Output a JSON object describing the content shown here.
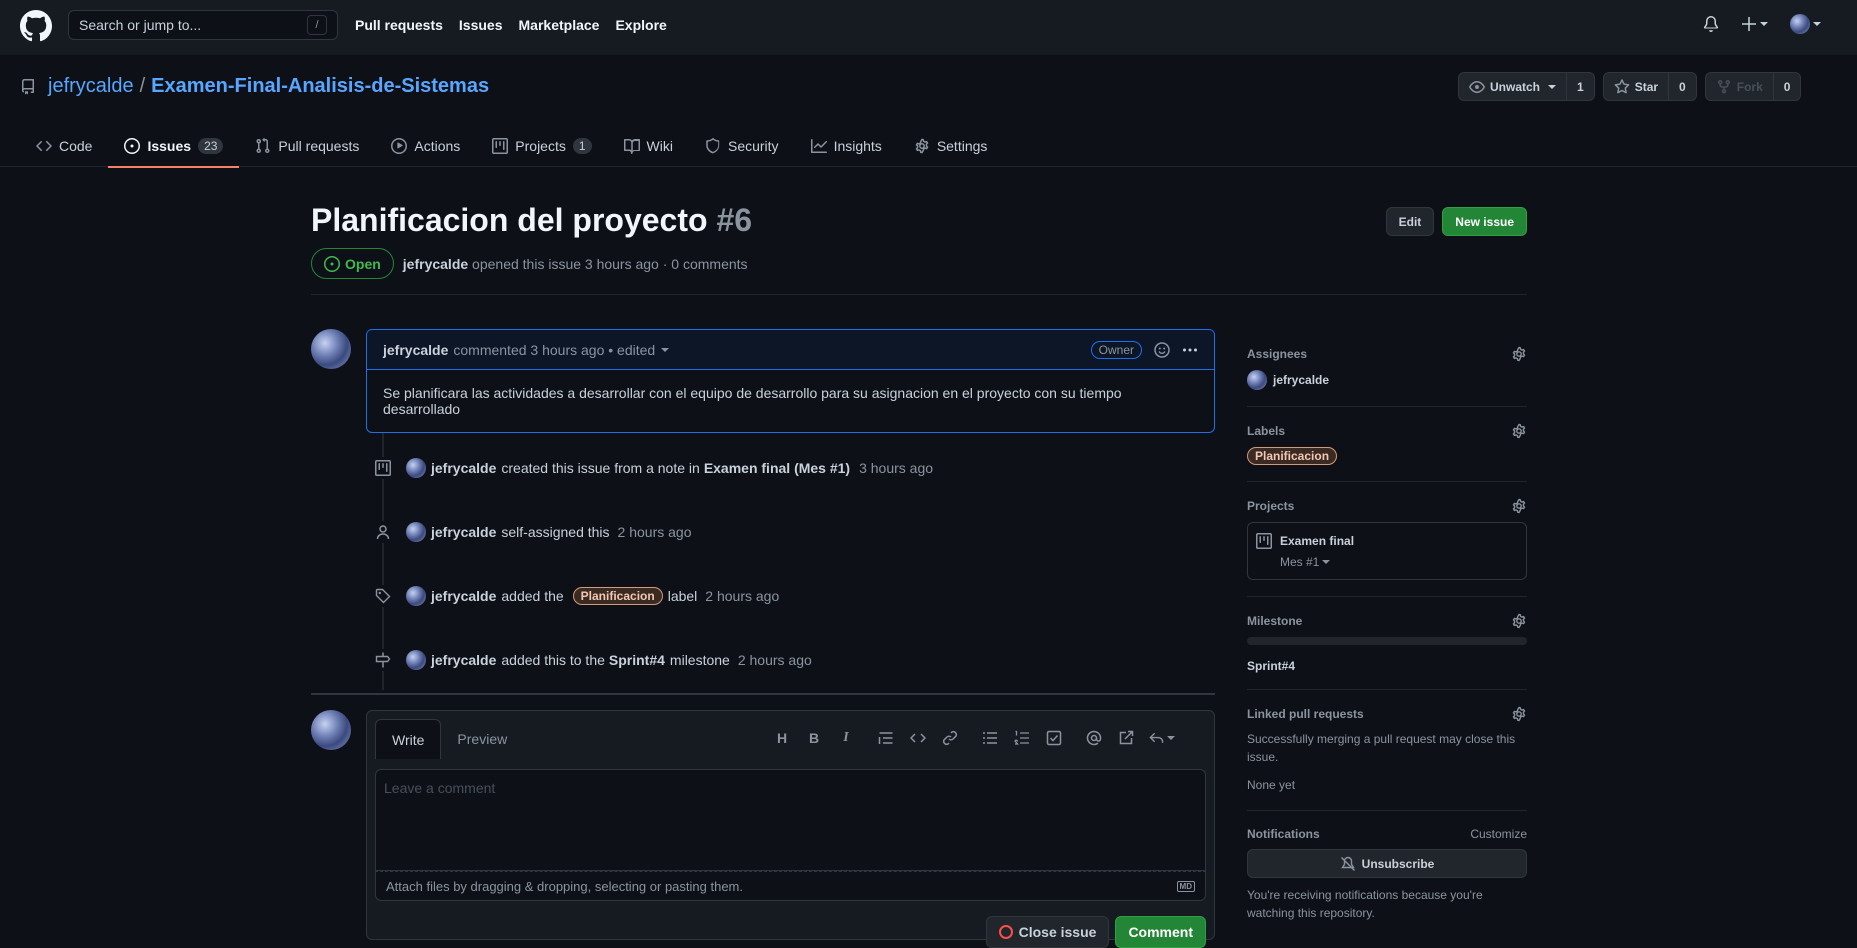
{
  "header": {
    "search_placeholder": "Search or jump to...",
    "search_shortcut": "/",
    "nav": [
      "Pull requests",
      "Issues",
      "Marketplace",
      "Explore"
    ]
  },
  "repo": {
    "owner": "jefrycalde",
    "separator": "/",
    "name": "Examen-Final-Analisis-de-Sistemas",
    "watch_label": "Unwatch",
    "watch_count": "1",
    "star_label": "Star",
    "star_count": "0",
    "fork_label": "Fork",
    "fork_count": "0"
  },
  "tabs": [
    {
      "label": "Code",
      "counter": ""
    },
    {
      "label": "Issues",
      "counter": "23"
    },
    {
      "label": "Pull requests",
      "counter": ""
    },
    {
      "label": "Actions",
      "counter": ""
    },
    {
      "label": "Projects",
      "counter": "1"
    },
    {
      "label": "Wiki",
      "counter": ""
    },
    {
      "label": "Security",
      "counter": ""
    },
    {
      "label": "Insights",
      "counter": ""
    },
    {
      "label": "Settings",
      "counter": ""
    }
  ],
  "issue": {
    "title": "Planificacion del proyecto",
    "number": "#6",
    "edit_label": "Edit",
    "new_issue_label": "New issue",
    "state": "Open",
    "author": "jefrycalde",
    "meta_text": "opened this issue 3 hours ago · 0 comments"
  },
  "comment": {
    "author": "jefrycalde",
    "action": "commented 3 hours ago • edited",
    "role": "Owner",
    "body": "Se planificara las actividades a desarrollar con el equipo de desarrollo para su asignacion en el proyecto con su tiempo desarrollado"
  },
  "events": [
    {
      "user": "jefrycalde",
      "text": "created this issue from a note in",
      "target": "Examen final (Mes #1)",
      "time": "3 hours ago"
    },
    {
      "user": "jefrycalde",
      "text": "self-assigned this",
      "target": "",
      "time": "2 hours ago"
    },
    {
      "user": "jefrycalde",
      "text": "added the",
      "label": "Planificacion",
      "text2": "label",
      "time": "2 hours ago"
    },
    {
      "user": "jefrycalde",
      "text": "added this to the",
      "target": "Sprint#4",
      "text2": "milestone",
      "time": "2 hours ago"
    }
  ],
  "composer": {
    "write_tab": "Write",
    "preview_tab": "Preview",
    "placeholder": "Leave a comment",
    "attach_text": "Attach files by dragging & dropping, selecting or pasting them.",
    "md_badge": "MD",
    "close_label": "Close issue",
    "comment_label": "Comment"
  },
  "sidebar": {
    "assignees_title": "Assignees",
    "assignee": "jefrycalde",
    "labels_title": "Labels",
    "label": "Planificacion",
    "projects_title": "Projects",
    "project_name": "Examen final",
    "project_column": "Mes #1",
    "milestone_title": "Milestone",
    "milestone": "Sprint#4",
    "linked_title": "Linked pull requests",
    "linked_text": "Successfully merging a pull request may close this issue.",
    "linked_none": "None yet",
    "notifications_title": "Notifications",
    "customize": "Customize",
    "unsubscribe": "Unsubscribe",
    "notif_text": "You're receiving notifications because you're watching this repository."
  },
  "colors": {
    "accent": "#58a6ff",
    "green": "#238636",
    "tab_underline": "#f78166"
  }
}
